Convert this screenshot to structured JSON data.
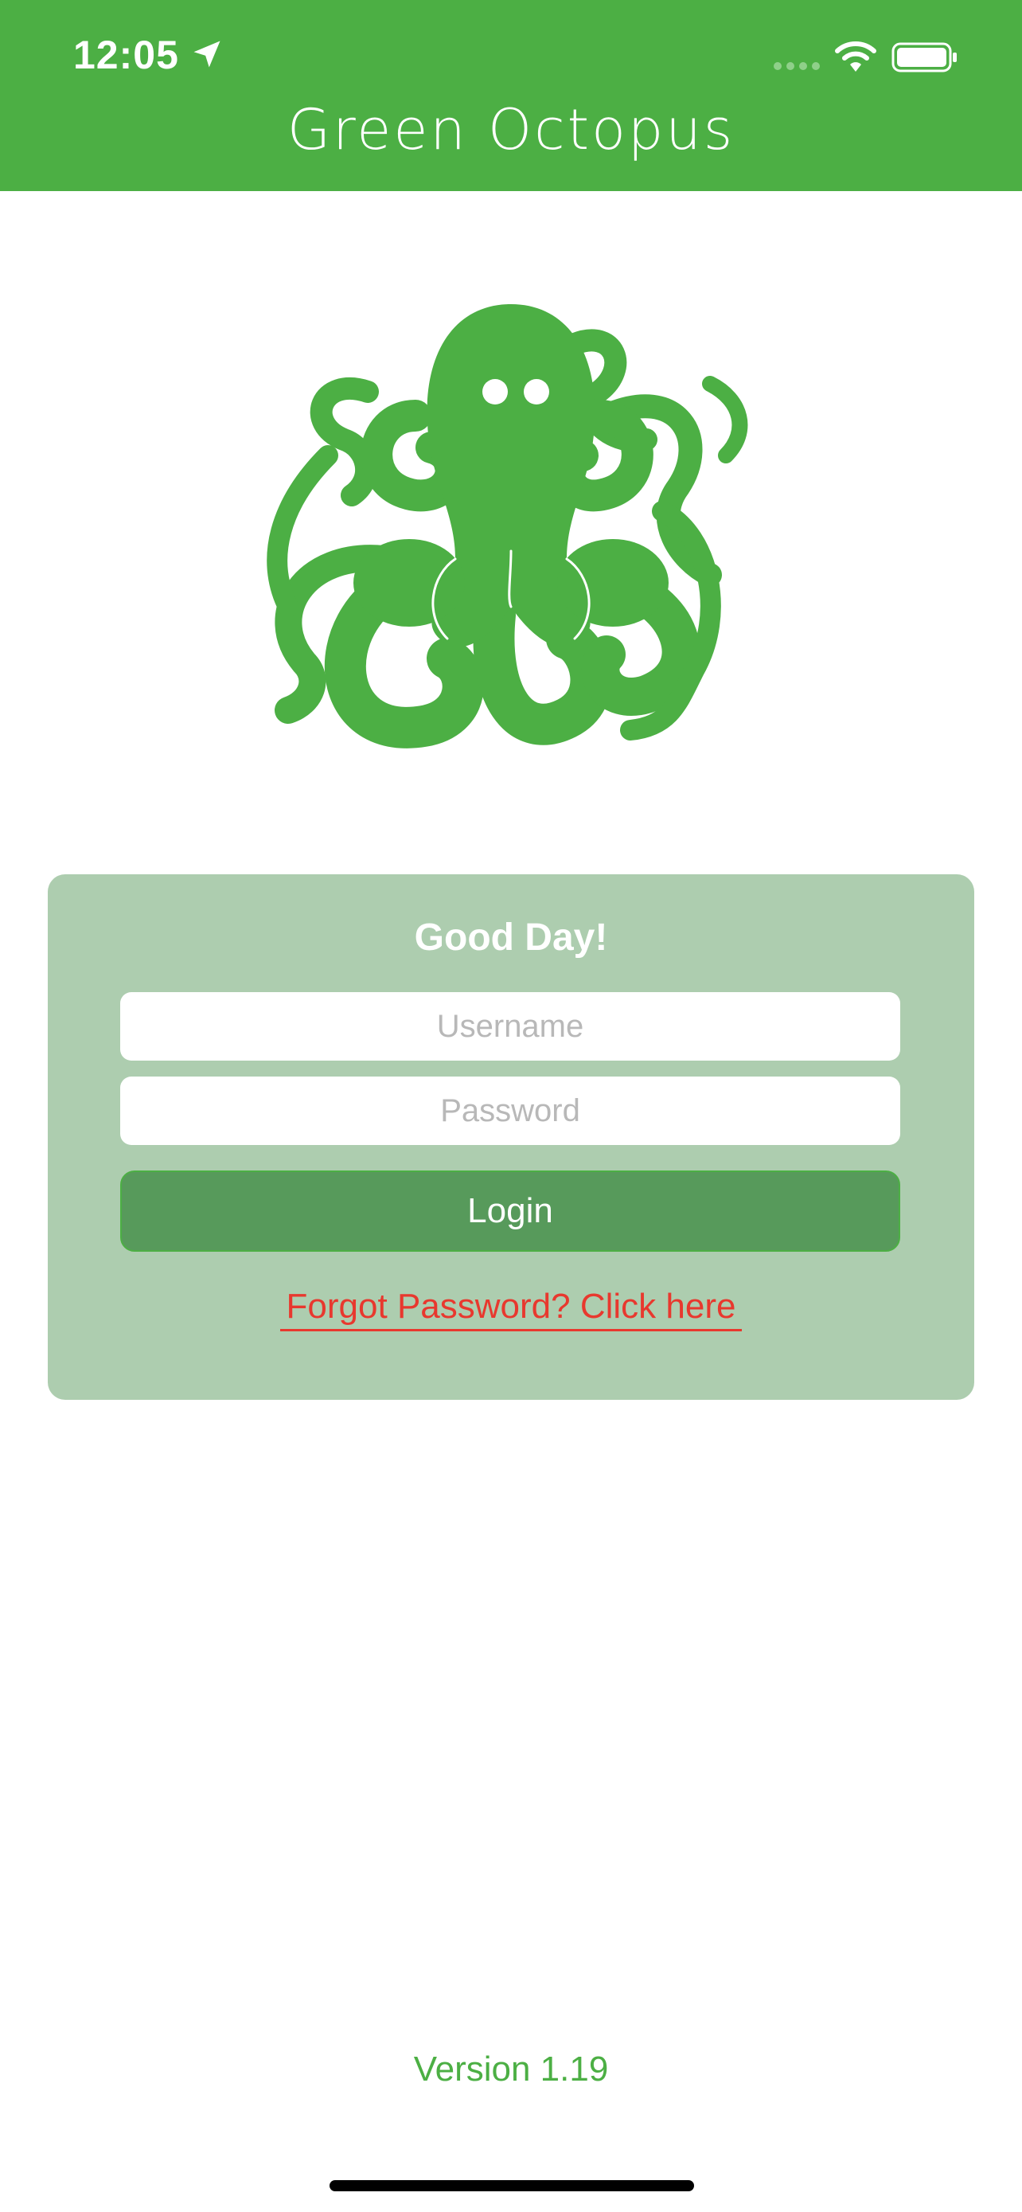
{
  "status_bar": {
    "time": "12:05",
    "location_icon": "location-arrow-icon",
    "signal_icon": "cellular-signal-icon",
    "wifi_icon": "wifi-icon",
    "battery_icon": "battery-icon"
  },
  "header": {
    "title": "Green Octopus",
    "background_color": "#4caf44"
  },
  "logo": {
    "icon": "octopus-logo",
    "color": "#4caf44"
  },
  "login_card": {
    "greeting": "Good Day!",
    "username_placeholder": "Username",
    "password_placeholder": "Password",
    "login_label": "Login",
    "forgot_label": "Forgot Password? Click here",
    "card_color": "#adcdaf",
    "button_color": "#579a5b",
    "link_color": "#e8382e"
  },
  "footer": {
    "version": "Version 1.19"
  }
}
